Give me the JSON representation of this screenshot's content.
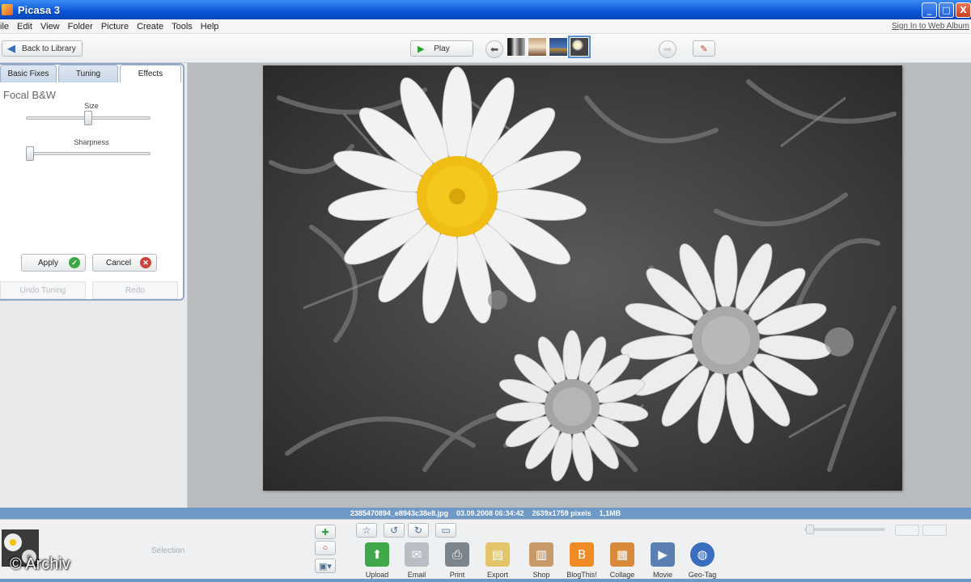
{
  "window": {
    "title": "Picasa 3",
    "min": "_",
    "max": "□",
    "close": "X"
  },
  "menu": [
    "ile",
    "Edit",
    "View",
    "Folder",
    "Picture",
    "Create",
    "Tools",
    "Help"
  ],
  "signin": "Sign In to Web Album",
  "toolbar": {
    "back_label": "Back to Library",
    "play_label": "Play"
  },
  "tabs": [
    "Basic Fixes",
    "Tuning",
    "Effects"
  ],
  "effect": {
    "title": "Focal B&W",
    "size_label": "Size",
    "sharpness_label": "Sharpness",
    "size_value": 0.5,
    "sharpness_value": 0.0,
    "apply_label": "Apply",
    "cancel_label": "Cancel",
    "undo_label": "Undo Tuning",
    "redo_label": "Redo"
  },
  "info": {
    "filename": "2385470894_e8943c38e8.jpg",
    "datetime": "03.09.2008 06:34:42",
    "dimensions": "2639x1759 pixels",
    "size": "1,1MB"
  },
  "tray": {
    "selection_label": "Selection",
    "watermark": "© Archiv"
  },
  "actions": [
    {
      "label": "Upload",
      "icon": "upload-icon",
      "color": "#3fa84a",
      "glyph": "⬆"
    },
    {
      "label": "Email",
      "icon": "email-icon",
      "color": "#b8bec4",
      "glyph": "✉"
    },
    {
      "label": "Print",
      "icon": "print-icon",
      "color": "#7d858c",
      "glyph": "⎙"
    },
    {
      "label": "Export",
      "icon": "folder-icon",
      "color": "#e3c46a",
      "glyph": "▤"
    },
    {
      "label": "Shop",
      "icon": "shop-icon",
      "color": "#c89a6a",
      "glyph": "▥"
    },
    {
      "label": "BlogThis!",
      "icon": "blogger-icon",
      "color": "#f08a24",
      "glyph": "B"
    },
    {
      "label": "Collage",
      "icon": "collage-icon",
      "color": "#d9893a",
      "glyph": "▦"
    },
    {
      "label": "Movie",
      "icon": "movie-icon",
      "color": "#5a7fb0",
      "glyph": "▶"
    },
    {
      "label": "Geo-Tag",
      "icon": "globe-icon",
      "color": "#3a6fc0",
      "glyph": "◍"
    }
  ]
}
